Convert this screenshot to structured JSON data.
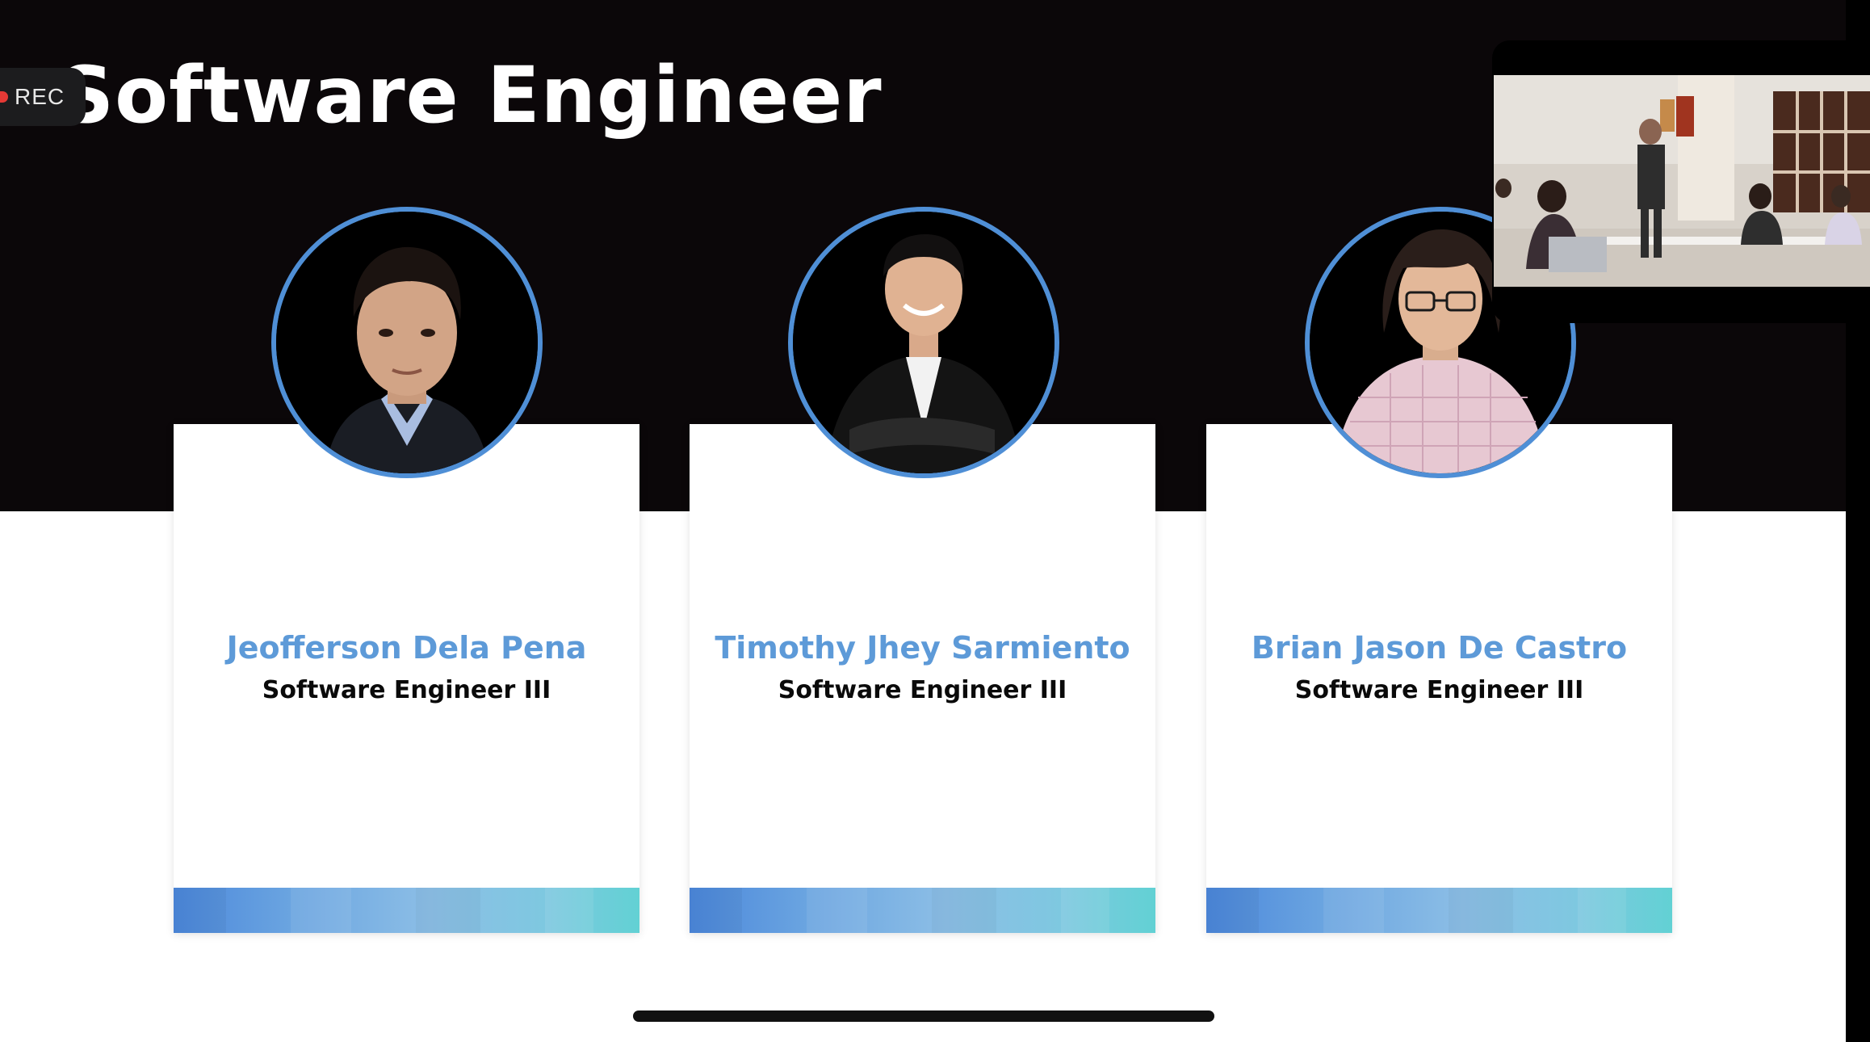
{
  "slide": {
    "title": "Software Engineer",
    "team": [
      {
        "name": "Jeofferson Dela Pena",
        "role": "Software Engineer III"
      },
      {
        "name": "Timothy Jhey Sarmiento",
        "role": "Software Engineer III"
      },
      {
        "name": "Brian Jason De Castro",
        "role": "Software Engineer III"
      }
    ]
  },
  "recording": {
    "label": "REC"
  },
  "colors": {
    "name_blue": "#5d9ad8",
    "ring_blue": "#4f8fd6",
    "dark_band": "#0b0709",
    "rec_red": "#e53935"
  }
}
